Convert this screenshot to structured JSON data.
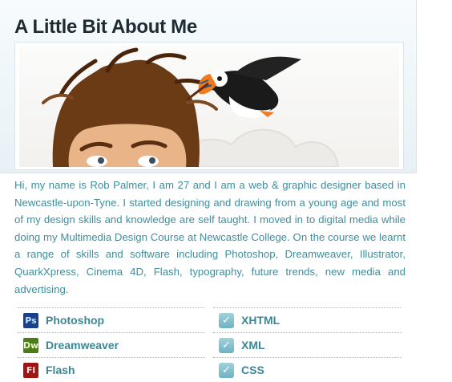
{
  "page": {
    "title": "A Little Bit About Me"
  },
  "bio": "Hi, my name is Rob Palmer, I am 27 and I am a web & graphic designer based in Newcastle-upon-Tyne. I started designing and drawing from a young age and most of my design skills and knowledge are self taught. I moved in to digital media while doing my Multimedia Design Course at Newcastle College. On the course we learnt a range of skills and software including Photoshop, Dreamweaver, Illustrator, QuarkXpress, Cinema 4D, Flash, typography, future trends, new media and advertising.",
  "software": [
    {
      "label": "Photoshop",
      "abbr": "Ps",
      "icon": "photoshop-icon",
      "bg": "#1b3f8a",
      "fg": "#bfe3ff"
    },
    {
      "label": "Dreamweaver",
      "abbr": "Dw",
      "icon": "dreamweaver-icon",
      "bg": "#4b7d16",
      "fg": "#e9f7c8"
    },
    {
      "label": "Flash",
      "abbr": "Fl",
      "icon": "flash-icon",
      "bg": "#a01414",
      "fg": "#ffe0e0"
    }
  ],
  "languages": [
    {
      "label": "XHTML",
      "icon": "checkmark-icon"
    },
    {
      "label": "XML",
      "icon": "checkmark-icon"
    },
    {
      "label": "CSS",
      "icon": "checkmark-icon"
    }
  ],
  "colors": {
    "title": "#1d2b33",
    "text": "#3f8e9c",
    "skill": "#3a8796"
  }
}
